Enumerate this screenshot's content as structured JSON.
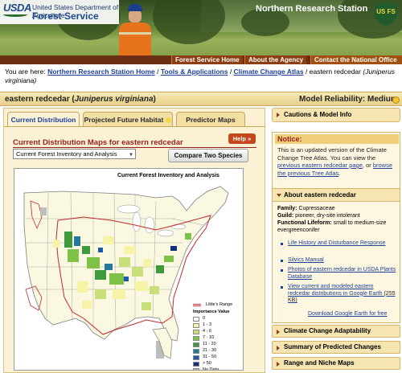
{
  "header": {
    "agency_line1": "United States Department of Agriculture",
    "agency_line2": "Forest Service",
    "usda_text": "USDA",
    "station_name": "Northern Research Station",
    "shield_text": "US FS"
  },
  "topnav": {
    "items": [
      "Forest Service Home",
      "About the Agency",
      "Contact the National Office"
    ]
  },
  "breadcrumb": {
    "prefix": "You are here: ",
    "links": [
      "Northern Research Station Home",
      "Tools & Applications",
      "Climate Change Atlas"
    ],
    "separator": " / ",
    "current": "eastern redcedar",
    "current_latin": "(Juniperus virginiana)"
  },
  "title": {
    "common": "eastern redcedar",
    "latin": "Juniperus virginiana",
    "reliability": "Model Reliability: Medium"
  },
  "tabs": [
    "Current Distribution",
    "Projected Future Habitat",
    "Predictor Maps"
  ],
  "main": {
    "heading": "Current Distribution Maps for eastern redcedar",
    "help_label": "Help »",
    "select_value": "Current Forest Inventory and Analysis",
    "compare_label": "Compare Two Species",
    "map_title": "Current Forest Inventory and Analysis"
  },
  "legend": {
    "range_label": "Little's Range",
    "title": "Importance Value",
    "items": [
      {
        "label": "0",
        "color": "#ffffff"
      },
      {
        "label": "1 - 3",
        "color": "#f6f3a6"
      },
      {
        "label": "4 - 6",
        "color": "#c9e07a"
      },
      {
        "label": "7 - 10",
        "color": "#7fc24a"
      },
      {
        "label": "11 - 20",
        "color": "#3f9a3d"
      },
      {
        "label": "21 - 30",
        "color": "#24789a"
      },
      {
        "label": "31 - 50",
        "color": "#1f5aa6"
      },
      {
        "label": "> 50",
        "color": "#13307d"
      },
      {
        "label": "No Data",
        "color": "#bdbdbd"
      }
    ]
  },
  "sidebar": {
    "cautions": "Cautions & Model Info",
    "notice_title": "Notice:",
    "notice_pre": "This is an updated version of the Climate Change Tree Atlas. You can view the ",
    "notice_link1": "previous eastern redcedar page",
    "notice_mid": ", or ",
    "notice_link2": "browse the previous Tree Atlas",
    "notice_post": ".",
    "about_title": "About eastern redcedar",
    "family_label": "Family:",
    "family_value": "Cupressaceae",
    "guild_label": "Guild:",
    "guild_value": "pioneer, dry-site intolerant",
    "lifeform_label": "Functional Lifeform:",
    "lifeform_value": "small to medium-size evergreenconifer",
    "links": [
      "Life History and Disturbance Response",
      "Silvics Manual",
      "Photos of eastern redcedar in USDA Plants Database",
      "View current and modeled eastern redcedar distributions in Google Earth"
    ],
    "link_size": "(255 KB)",
    "download_label": "Download Google Earth for free",
    "sections": [
      "Climate Change Adaptability",
      "Summary of Predicted Changes",
      "Range and Niche Maps"
    ]
  },
  "colors": {
    "nav_bg": "#8c3d12",
    "title_bg": "#f7e9b4",
    "heading_red": "#9b1d1d",
    "link_blue": "#1c3f99"
  }
}
